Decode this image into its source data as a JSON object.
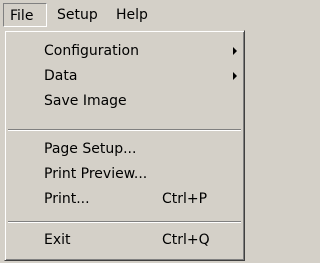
{
  "menubar": {
    "items": [
      {
        "label": "File",
        "state": "open"
      },
      {
        "label": "Setup"
      },
      {
        "label": "Help"
      }
    ]
  },
  "file_menu": {
    "items": [
      {
        "label": "Configuration",
        "submenu": true,
        "icon": "submenu-arrow-icon"
      },
      {
        "label": "Data",
        "submenu": true,
        "icon": "submenu-arrow-icon"
      },
      {
        "label": "Save Image"
      },
      {
        "label": "Page Setup..."
      },
      {
        "label": "Print Preview..."
      },
      {
        "label": "Print...",
        "shortcut": "Ctrl+P"
      },
      {
        "label": "Exit",
        "shortcut": "Ctrl+Q"
      }
    ]
  },
  "colors": {
    "face": "#d4d0c8",
    "highlight": "#ffffff",
    "shadow": "#808080",
    "dark_shadow": "#404040",
    "text": "#000000"
  }
}
